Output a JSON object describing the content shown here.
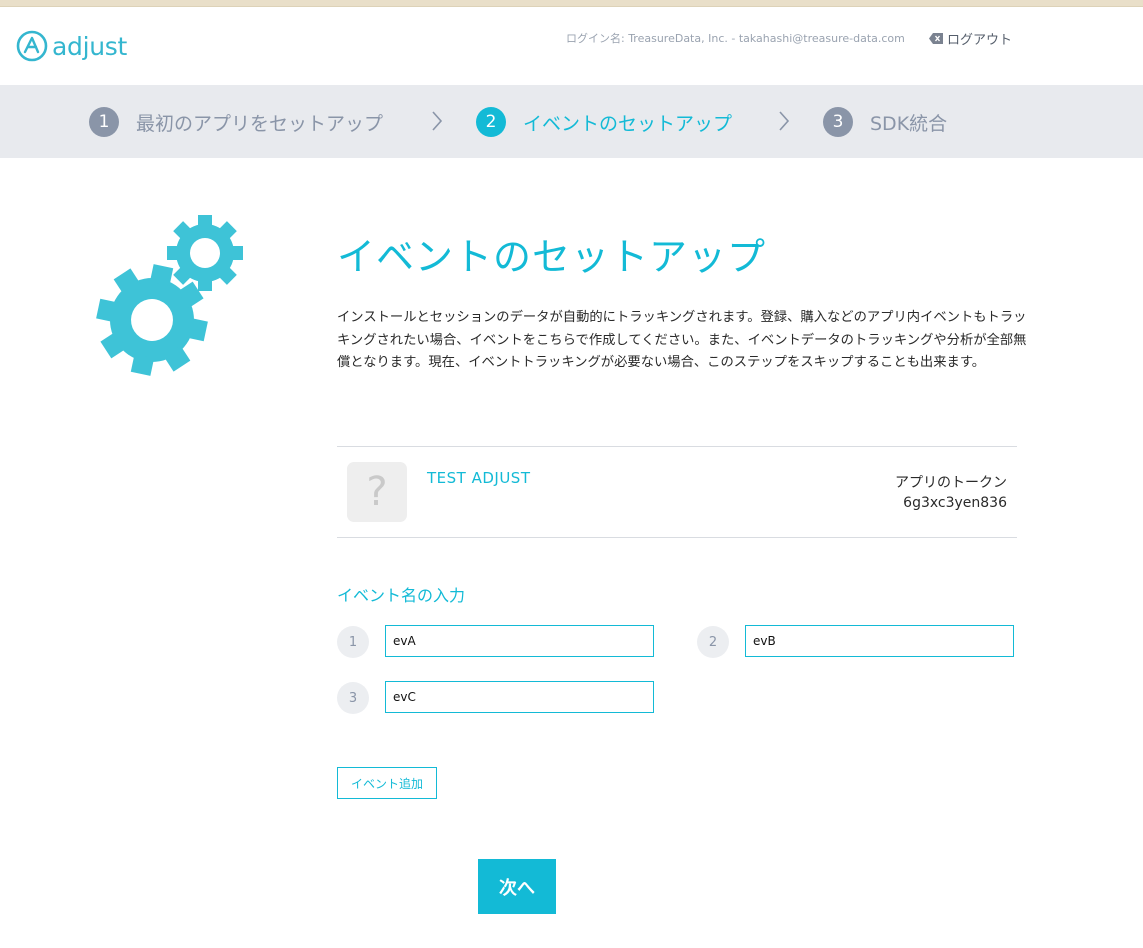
{
  "colors": {
    "accent": "#13bad6",
    "step_inactive": "#8a95a8",
    "steps_bar_bg": "#e8eaee",
    "gear_color": "#3ec3d7"
  },
  "header": {
    "logo_text": "adjust",
    "login_info": "ログイン名: TreasureData, Inc. - takahashi@treasure-data.com",
    "logout_label": "ログアウト"
  },
  "steps": [
    {
      "num": "1",
      "label": "最初のアプリをセットアップ",
      "active": false
    },
    {
      "num": "2",
      "label": "イベントのセットアップ",
      "active": true
    },
    {
      "num": "3",
      "label": "SDK統合",
      "active": false
    }
  ],
  "main": {
    "title": "イベントのセットアップ",
    "intro": "インストールとセッションのデータが自動的にトラッキングされます。登録、購入などのアプリ内イベントもトラッキングされたい場合、イベントをこちらで作成してください。また、イベントデータのトラッキングや分析が全部無償となります。現在、イベントトラッキングが必要ない場合、このステップをスキップすることも出来ます。"
  },
  "app": {
    "icon_glyph": "?",
    "name": "TEST ADJUST",
    "token_label": "アプリのトークン",
    "token_value": "6g3xc3yen836"
  },
  "events": {
    "section_title": "イベント名の入力",
    "items": [
      {
        "num": "1",
        "value": "evA"
      },
      {
        "num": "2",
        "value": "evB"
      },
      {
        "num": "3",
        "value": "evC"
      }
    ],
    "add_label": "イベント追加"
  },
  "next_label": "次へ"
}
